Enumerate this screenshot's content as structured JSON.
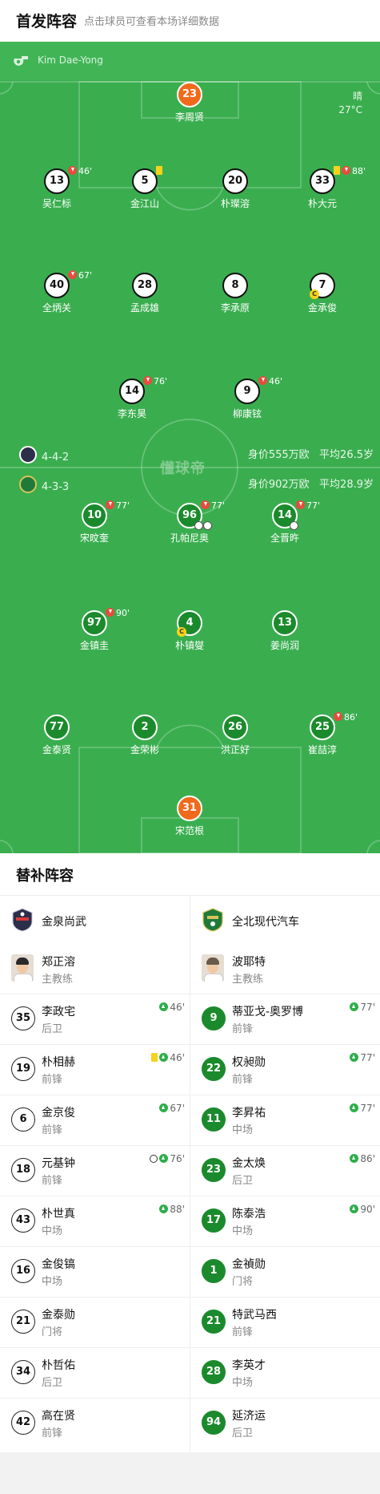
{
  "header": {
    "title": "首发阵容",
    "subtitle": "点击球员可查看本场详细数据"
  },
  "referee": {
    "name": "Kim Dae-Yong",
    "icon": "whistle-icon"
  },
  "weather": {
    "condition": "晴",
    "temperature": "27°C"
  },
  "watermark": "懂球帝",
  "home_team": {
    "formation": "4-4-2",
    "value": "身价555万欧",
    "avg_age": "平均26.5岁",
    "players": [
      {
        "num": "23",
        "name": "李周贤",
        "role": "gk"
      },
      {
        "num": "13",
        "name": "吴仁标",
        "sub_out": "46'"
      },
      {
        "num": "5",
        "name": "金江山",
        "yellow": true
      },
      {
        "num": "20",
        "name": "朴璨溶"
      },
      {
        "num": "33",
        "name": "朴大元",
        "yellow": true,
        "sub_out": "88'"
      },
      {
        "num": "40",
        "name": "全炳关",
        "sub_out": "67'"
      },
      {
        "num": "28",
        "name": "孟成雄"
      },
      {
        "num": "8",
        "name": "李承原"
      },
      {
        "num": "7",
        "name": "金承俊",
        "captain": "C"
      },
      {
        "num": "14",
        "name": "李东昊",
        "sub_out": "76'"
      },
      {
        "num": "9",
        "name": "柳康铉",
        "sub_out": "46'"
      }
    ]
  },
  "away_team": {
    "formation": "4-3-3",
    "value": "身价902万欧",
    "avg_age": "平均28.9岁",
    "players": [
      {
        "num": "10",
        "name": "宋旼奎",
        "sub_out": "77'"
      },
      {
        "num": "96",
        "name": "孔帕尼奥",
        "sub_out": "77'",
        "goals": 2
      },
      {
        "num": "14",
        "name": "全晋旿",
        "sub_out": "77'",
        "goals": 1
      },
      {
        "num": "97",
        "name": "金镇圭",
        "sub_out": "90'"
      },
      {
        "num": "4",
        "name": "朴镇燮",
        "captain": "C"
      },
      {
        "num": "13",
        "name": "姜尚润"
      },
      {
        "num": "77",
        "name": "金泰贤"
      },
      {
        "num": "2",
        "name": "金荣彬"
      },
      {
        "num": "26",
        "name": "洪正好"
      },
      {
        "num": "25",
        "name": "崔喆淳",
        "sub_out": "86'"
      },
      {
        "num": "31",
        "name": "宋范根",
        "role": "gk"
      }
    ]
  },
  "subs": {
    "title": "替补阵容",
    "home": {
      "team_name": "金泉尚武",
      "coach": {
        "name": "郑正溶",
        "role": "主教练"
      },
      "players": [
        {
          "num": "35",
          "name": "李政宅",
          "pos": "后卫",
          "event": "46'"
        },
        {
          "num": "19",
          "name": "朴相赫",
          "pos": "前锋",
          "event": "46'",
          "yellow": true
        },
        {
          "num": "6",
          "name": "金京俊",
          "pos": "前锋",
          "event": "67'"
        },
        {
          "num": "18",
          "name": "元基钟",
          "pos": "前锋",
          "event": "76'",
          "goal": true
        },
        {
          "num": "43",
          "name": "朴世真",
          "pos": "中场",
          "event": "88'"
        },
        {
          "num": "16",
          "name": "金俊镐",
          "pos": "中场",
          "event": ""
        },
        {
          "num": "21",
          "name": "金泰勋",
          "pos": "门将",
          "event": ""
        },
        {
          "num": "34",
          "name": "朴哲佑",
          "pos": "后卫",
          "event": ""
        },
        {
          "num": "42",
          "name": "高在贤",
          "pos": "前锋",
          "event": ""
        }
      ]
    },
    "away": {
      "team_name": "全北现代汽车",
      "coach": {
        "name": "波耶特",
        "role": "主教练"
      },
      "players": [
        {
          "num": "9",
          "name": "蒂亚戈-奥罗博",
          "pos": "前锋",
          "event": "77'"
        },
        {
          "num": "22",
          "name": "权昶勋",
          "pos": "前锋",
          "event": "77'"
        },
        {
          "num": "11",
          "name": "李昇祐",
          "pos": "中场",
          "event": "77'"
        },
        {
          "num": "23",
          "name": "金太焕",
          "pos": "后卫",
          "event": "86'"
        },
        {
          "num": "17",
          "name": "陈泰浩",
          "pos": "中场",
          "event": "90'"
        },
        {
          "num": "1",
          "name": "金禎勋",
          "pos": "门将",
          "event": ""
        },
        {
          "num": "21",
          "name": "特武马西",
          "pos": "前锋",
          "event": ""
        },
        {
          "num": "28",
          "name": "李英才",
          "pos": "中场",
          "event": ""
        },
        {
          "num": "94",
          "name": "延济运",
          "pos": "后卫",
          "event": ""
        }
      ]
    }
  },
  "colors": {
    "pitch": "#3aae4f",
    "away_circle": "#1b8a2c",
    "gk_circle": "#f06a1c",
    "sub_out": "#e84b3c",
    "sub_in": "#2eae4a",
    "yellow_card": "#f7d21a"
  }
}
